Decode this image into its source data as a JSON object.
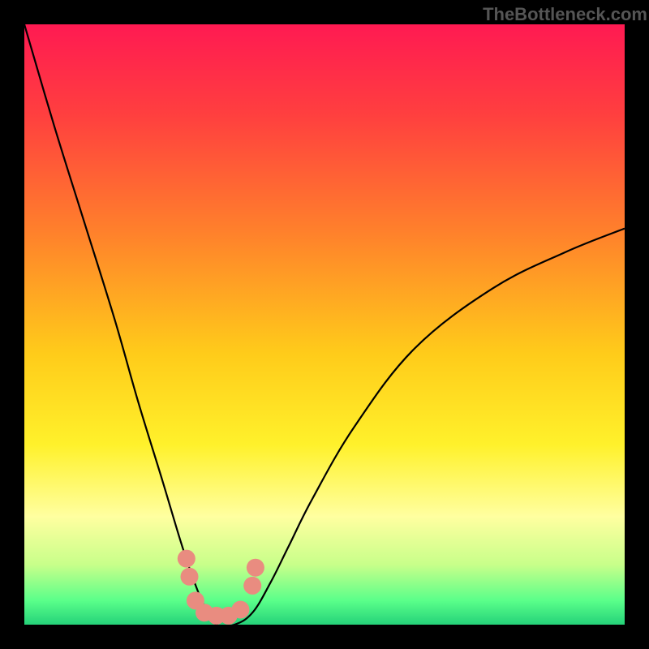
{
  "watermark": "TheBottleneck.com",
  "chart_data": {
    "type": "line",
    "title": "",
    "xlabel": "",
    "ylabel": "",
    "xlim": [
      0,
      100
    ],
    "ylim": [
      0,
      100
    ],
    "grid": false,
    "background_gradient": {
      "stops": [
        {
          "offset": 0.0,
          "color": "#ff1a52"
        },
        {
          "offset": 0.15,
          "color": "#ff3f3f"
        },
        {
          "offset": 0.35,
          "color": "#ff822b"
        },
        {
          "offset": 0.55,
          "color": "#ffcc1a"
        },
        {
          "offset": 0.7,
          "color": "#fff12b"
        },
        {
          "offset": 0.82,
          "color": "#ffffa0"
        },
        {
          "offset": 0.9,
          "color": "#c8ff8a"
        },
        {
          "offset": 0.96,
          "color": "#5aff8a"
        },
        {
          "offset": 1.0,
          "color": "#25d279"
        }
      ]
    },
    "series": [
      {
        "name": "bottleneck-curve",
        "color": "#000000",
        "x": [
          0,
          5,
          10,
          15,
          19,
          23,
          26,
          28,
          30,
          32,
          35,
          38,
          41,
          44,
          48,
          55,
          65,
          78,
          90,
          100
        ],
        "y": [
          100,
          83,
          67,
          51,
          37,
          24,
          14,
          8,
          3,
          0,
          0,
          2,
          7,
          13,
          21,
          33,
          46,
          56,
          62,
          66
        ]
      }
    ],
    "markers": [
      {
        "name": "marker-cluster",
        "color": "#e98c80",
        "points": [
          {
            "x": 27.0,
            "y": 11.0
          },
          {
            "x": 27.5,
            "y": 8.0
          },
          {
            "x": 28.5,
            "y": 4.0
          },
          {
            "x": 30.0,
            "y": 2.0
          },
          {
            "x": 32.0,
            "y": 1.5
          },
          {
            "x": 34.0,
            "y": 1.5
          },
          {
            "x": 36.0,
            "y": 2.5
          },
          {
            "x": 38.0,
            "y": 6.5
          },
          {
            "x": 38.5,
            "y": 9.5
          }
        ]
      }
    ]
  }
}
